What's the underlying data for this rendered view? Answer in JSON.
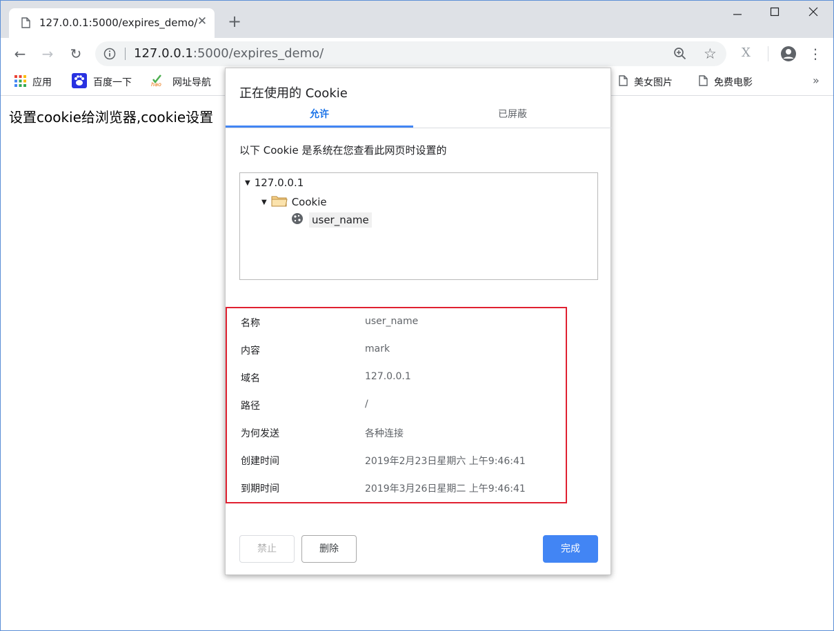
{
  "tab": {
    "title": "127.0.0.1:5000/expires_demo/",
    "close": "✕",
    "new_tab": "+"
  },
  "window_controls": {
    "minimize": "—",
    "maximize": "☐",
    "close": "✕"
  },
  "toolbar": {
    "back": "←",
    "forward": "→",
    "reload": "↻",
    "url_host": "127.0.0.1",
    "url_rest": ":5000/expires_demo/",
    "bookmark_star": "☆",
    "menu": "⋮"
  },
  "bookmarks": {
    "items": [
      {
        "label": "应用",
        "icon": "apps-grid-icon"
      },
      {
        "label": "百度一下",
        "icon": "baidu-paw-icon"
      },
      {
        "label": "网址导航",
        "icon": "hao-icon"
      },
      {
        "label": "美女图片",
        "icon": "page-icon"
      },
      {
        "label": "免费电影",
        "icon": "page-icon"
      }
    ],
    "more": "»"
  },
  "page": {
    "text": "设置cookie给浏览器,cookie设置"
  },
  "dialog": {
    "title": "正在使用的 Cookie",
    "tabs": [
      "允许",
      "已屏蔽"
    ],
    "description": "以下 Cookie 是系统在您查看此网页时设置的",
    "tree": {
      "host": "127.0.0.1",
      "folder": "Cookie",
      "cookie": "user_name"
    },
    "details": [
      {
        "label": "名称",
        "value": "user_name"
      },
      {
        "label": "内容",
        "value": "mark"
      },
      {
        "label": "域名",
        "value": "127.0.0.1"
      },
      {
        "label": "路径",
        "value": "/"
      },
      {
        "label": "为何发送",
        "value": "各种连接"
      },
      {
        "label": "创建时间",
        "value": "2019年2月23日星期六 上午9:46:41"
      },
      {
        "label": "到期时间",
        "value": "2019年3月26日星期二 上午9:46:41"
      }
    ],
    "buttons": {
      "block": "禁止",
      "remove": "删除",
      "done": "完成"
    }
  },
  "colors": {
    "accent": "#4285f4",
    "highlight_border": "#e02030"
  }
}
